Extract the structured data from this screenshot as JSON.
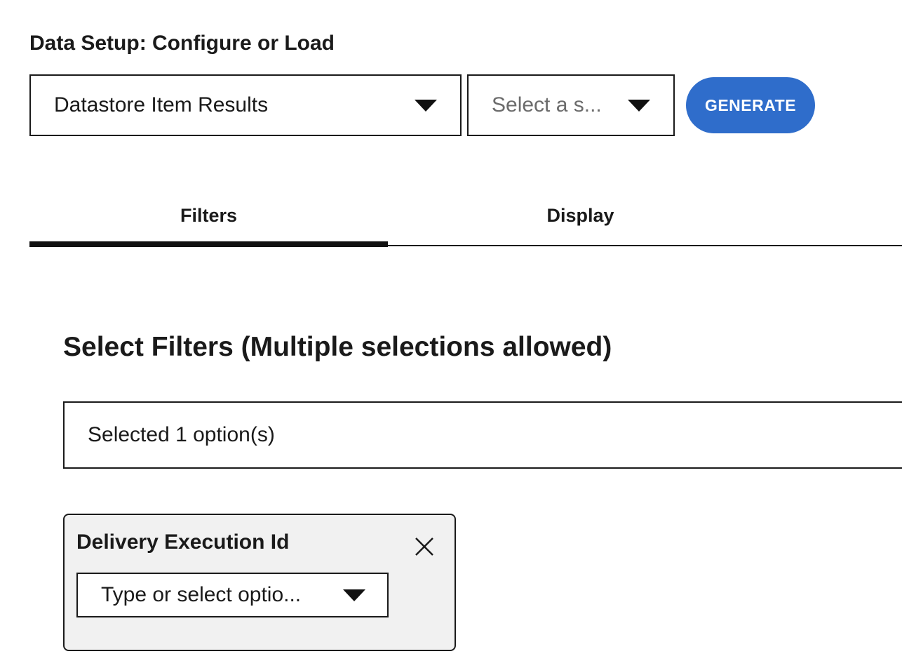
{
  "setup": {
    "title": "Data Setup: Configure or Load",
    "source_select_value": "Datastore Item Results",
    "saved_select_placeholder": "Select a s...",
    "generate_label": "GENERATE"
  },
  "tabs": [
    {
      "label": "Filters",
      "active": true
    },
    {
      "label": "Display",
      "active": false
    }
  ],
  "filters": {
    "heading": "Select Filters (Multiple selections allowed)",
    "multiselect_value": "Selected 1 option(s)",
    "cards": [
      {
        "title": "Delivery Execution Id",
        "value_placeholder": "Type or select optio..."
      }
    ]
  },
  "colors": {
    "accent": "#2f6dcb",
    "card_background": "#f1f1f1",
    "text": "#1a1a1a"
  },
  "icons": {
    "dropdown": "chevron-down-icon",
    "remove_filter": "close-icon"
  }
}
